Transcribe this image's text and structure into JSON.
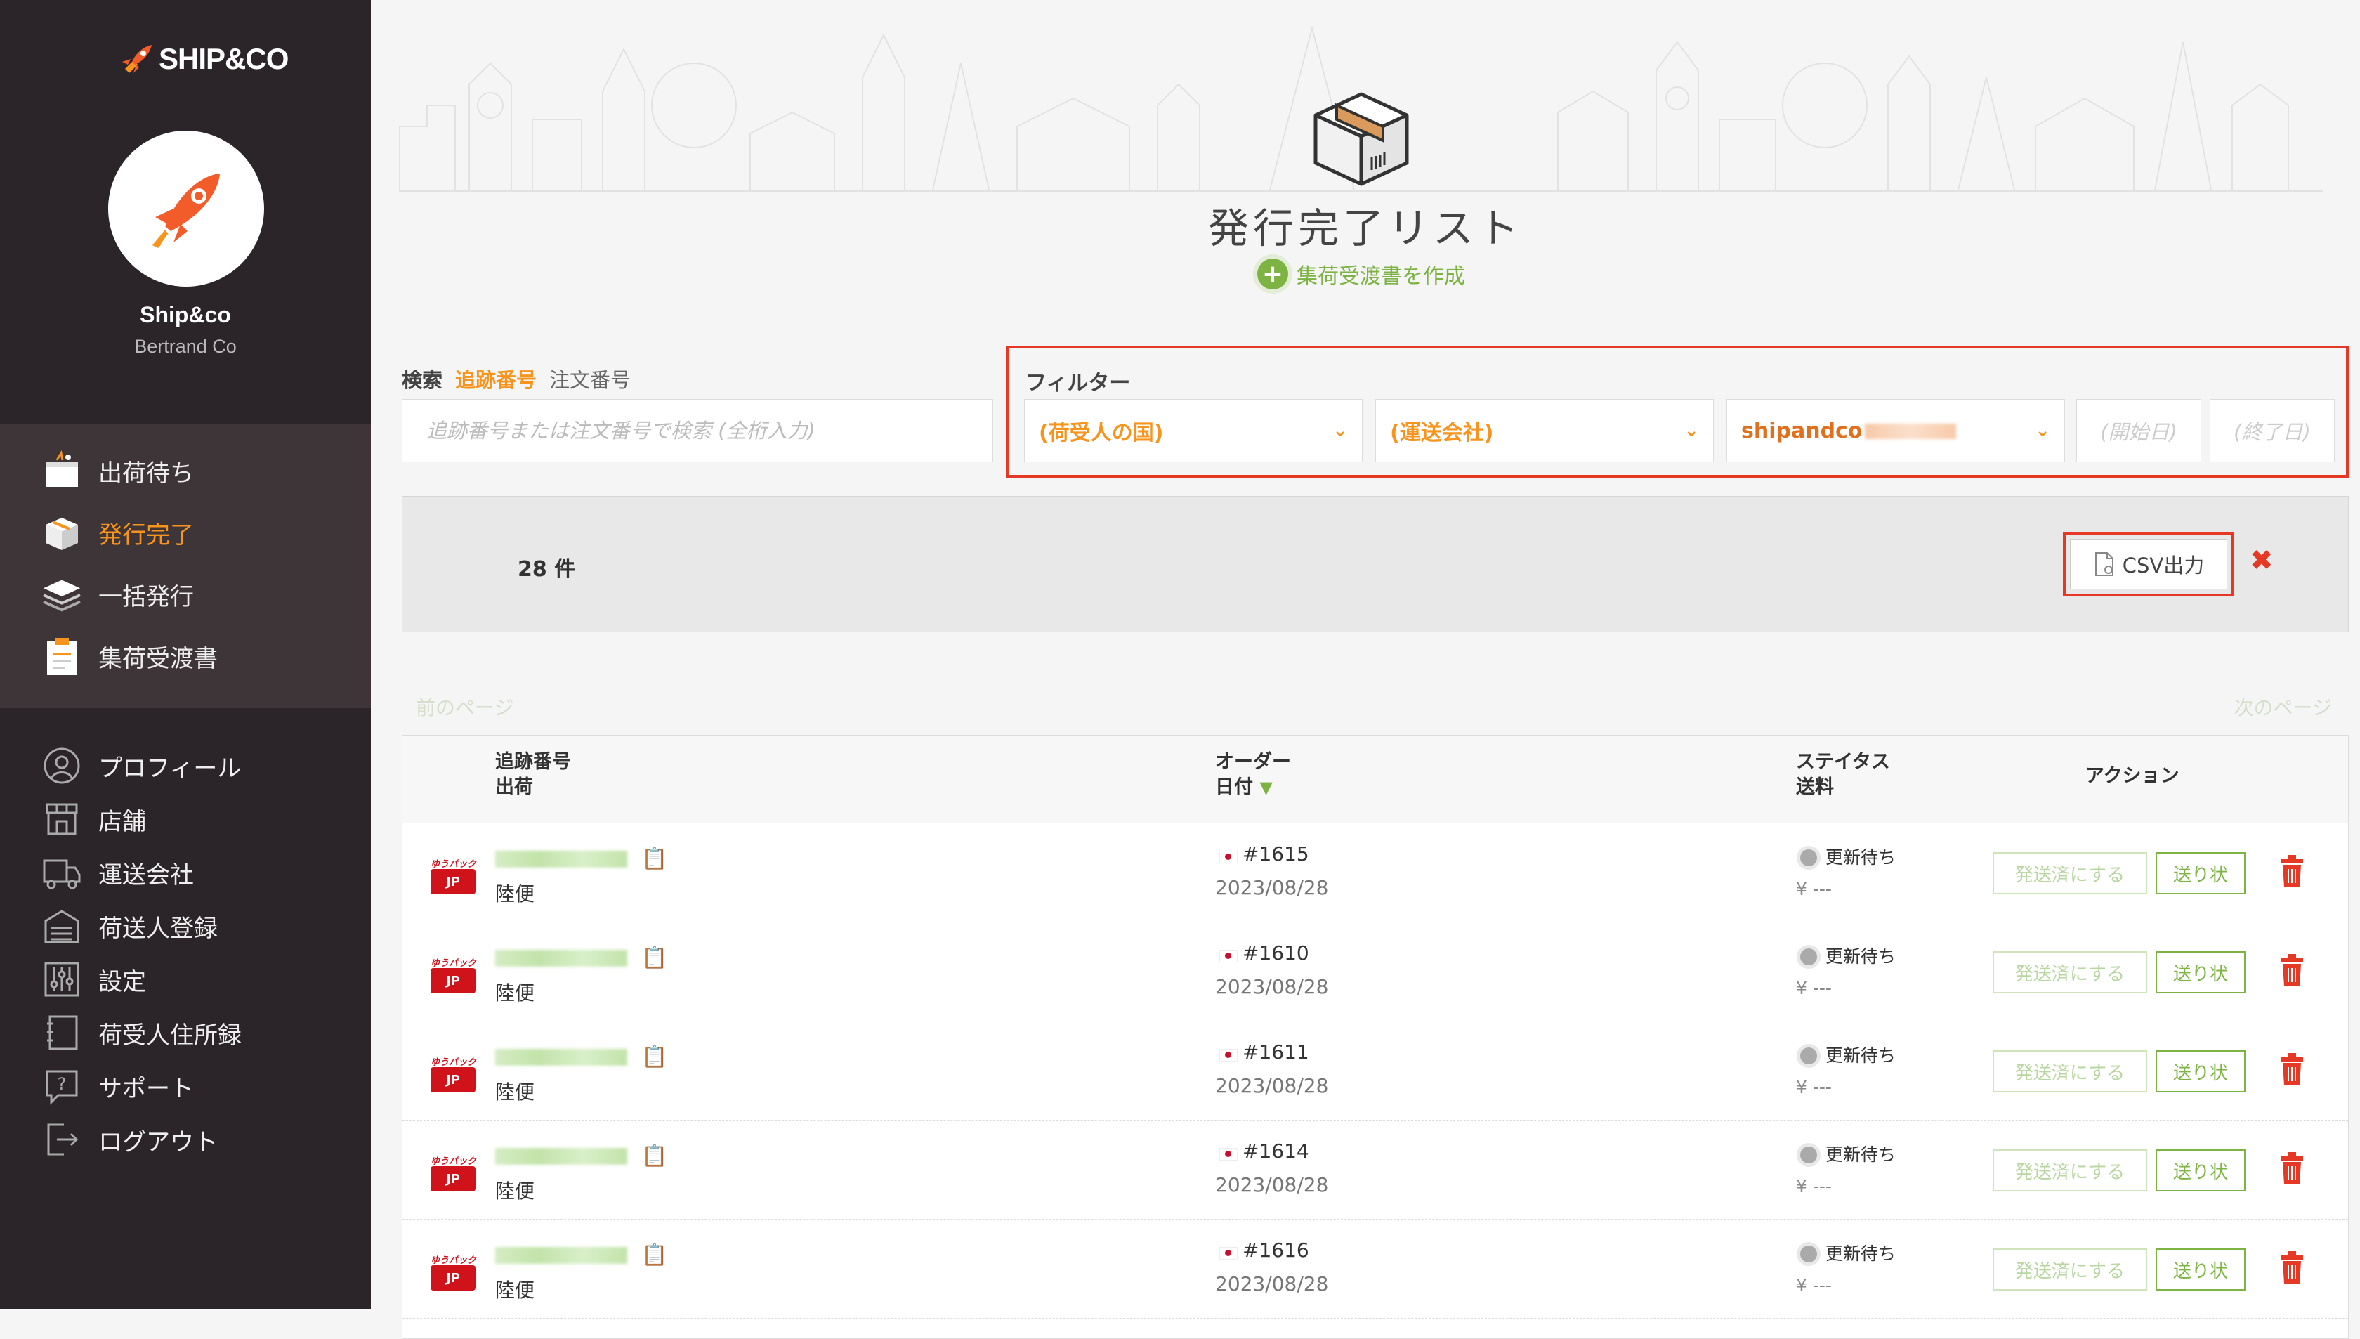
{
  "sidebar": {
    "logo_text": "SHIP&CO",
    "account_name": "Ship&co",
    "account_company": "Bertrand Co",
    "nav_top": [
      {
        "label": "出荷待ち",
        "icon": "package-pending-icon"
      },
      {
        "label": "発行完了",
        "icon": "box-open-icon",
        "active": true
      },
      {
        "label": "一括発行",
        "icon": "stack-icon"
      },
      {
        "label": "集荷受渡書",
        "icon": "clipboard-icon"
      }
    ],
    "nav_bottom": [
      {
        "label": "プロフィール",
        "icon": "user-icon"
      },
      {
        "label": "店舗",
        "icon": "store-icon"
      },
      {
        "label": "運送会社",
        "icon": "truck-icon"
      },
      {
        "label": "荷送人登録",
        "icon": "warehouse-icon"
      },
      {
        "label": "設定",
        "icon": "sliders-icon"
      },
      {
        "label": "荷受人住所録",
        "icon": "address-book-icon"
      },
      {
        "label": "サポート",
        "icon": "help-icon"
      },
      {
        "label": "ログアウト",
        "icon": "logout-icon"
      }
    ]
  },
  "header": {
    "title": "発行完了リスト",
    "create_link": "集荷受渡書を作成"
  },
  "search": {
    "label": "検索",
    "tab_tracking": "追跡番号",
    "tab_order": "注文番号",
    "placeholder": "追跡番号または注文番号で検索 (全桁入力)"
  },
  "filter": {
    "title": "フィルター",
    "country": "(荷受人の国)",
    "carrier": "(運送会社)",
    "shop": "shipandco",
    "start_date": "(開始日)",
    "end_date": "(終了日)"
  },
  "results": {
    "count": "28 件",
    "csv_button": "CSV出力"
  },
  "pagination": {
    "prev": "前のページ",
    "next": "次のページ"
  },
  "table": {
    "headers": {
      "tracking_line1": "追跡番号",
      "tracking_line2": "出荷",
      "order_line1": "オーダー",
      "order_line2": "日付",
      "status_line1": "ステイタス",
      "status_line2": "送料",
      "action": "アクション"
    },
    "rows": [
      {
        "carrier_top": "ゆうパック",
        "carrier_badge": "JP",
        "method": "陸便",
        "order": "#1615",
        "date": "2023/08/28",
        "status": "更新待ち",
        "fee": "¥ ---",
        "mark_sent": "発送済にする",
        "label_btn": "送り状"
      },
      {
        "carrier_top": "ゆうパック",
        "carrier_badge": "JP",
        "method": "陸便",
        "order": "#1610",
        "date": "2023/08/28",
        "status": "更新待ち",
        "fee": "¥ ---",
        "mark_sent": "発送済にする",
        "label_btn": "送り状"
      },
      {
        "carrier_top": "ゆうパック",
        "carrier_badge": "JP",
        "method": "陸便",
        "order": "#1611",
        "date": "2023/08/28",
        "status": "更新待ち",
        "fee": "¥ ---",
        "mark_sent": "発送済にする",
        "label_btn": "送り状"
      },
      {
        "carrier_top": "ゆうパック",
        "carrier_badge": "JP",
        "method": "陸便",
        "order": "#1614",
        "date": "2023/08/28",
        "status": "更新待ち",
        "fee": "¥ ---",
        "mark_sent": "発送済にする",
        "label_btn": "送り状"
      },
      {
        "carrier_top": "ゆうパック",
        "carrier_badge": "JP",
        "method": "陸便",
        "order": "#1616",
        "date": "2023/08/28",
        "status": "更新待ち",
        "fee": "¥ ---",
        "mark_sent": "発送済にする",
        "label_btn": "送り状"
      }
    ]
  },
  "colors": {
    "sidebar_bg": "#2b2428",
    "accent_orange": "#f7941d",
    "accent_green": "#7cb342",
    "highlight_red": "#e53925"
  }
}
